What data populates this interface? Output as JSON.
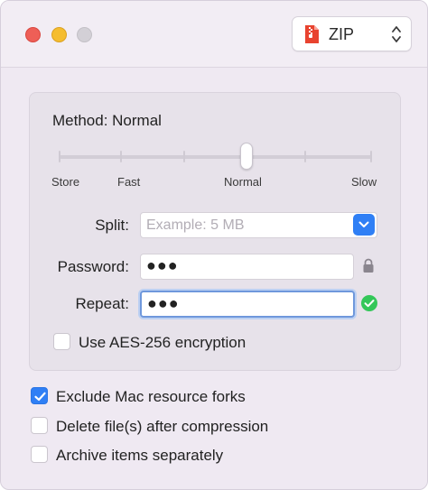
{
  "format": {
    "value": "ZIP"
  },
  "method": {
    "title": "Method: Normal",
    "level": 3,
    "levels": [
      "Store",
      "Fast",
      "Normal",
      "Slow"
    ]
  },
  "fields": {
    "split_label": "Split:",
    "split_placeholder": "Example: 5 MB",
    "password_label": "Password:",
    "password_value": "●●●",
    "repeat_label": "Repeat:",
    "repeat_value": "●●●"
  },
  "options": {
    "aes": {
      "label": "Use AES-256 encryption",
      "checked": false
    },
    "exclude_forks": {
      "label": "Exclude Mac resource forks",
      "checked": true
    },
    "delete_after": {
      "label": "Delete file(s) after compression",
      "checked": false
    },
    "separately": {
      "label": "Archive items separately",
      "checked": false
    }
  },
  "colors": {
    "accent": "#2f7ff5",
    "success": "#34c759",
    "close": "#ee5f57",
    "minimize": "#f5bd2f",
    "zoom": "#d3d0d6"
  },
  "icons": [
    "zip-file-icon",
    "updown-chevron-icon",
    "chevron-down-icon",
    "lock-icon",
    "checkmark-circle-icon",
    "checkmark-icon"
  ]
}
